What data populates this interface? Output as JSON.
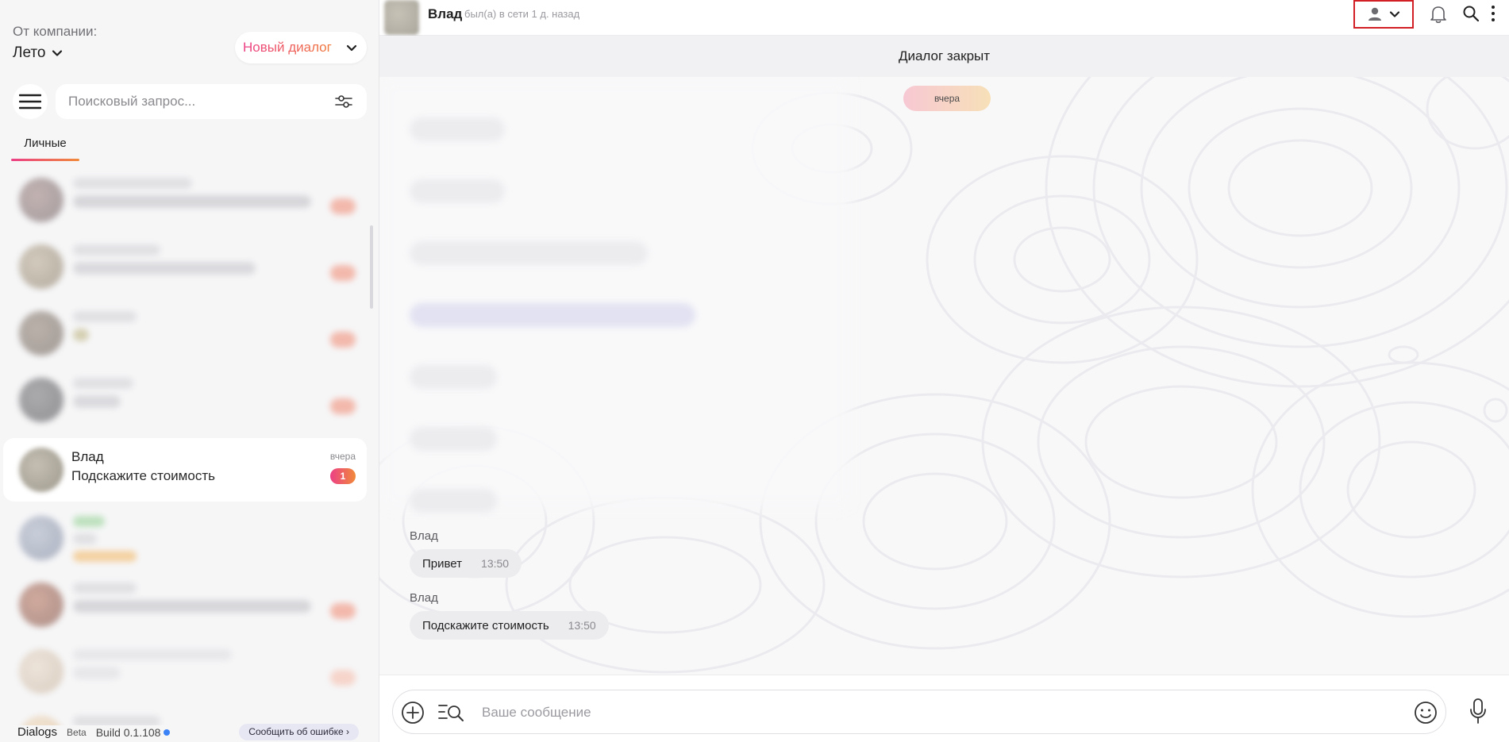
{
  "sidebar": {
    "company_label": "От компании:",
    "company_value": "Лето",
    "new_dialog_label": "Новый диалог",
    "search_placeholder": "Поисковый запрос...",
    "tabs": [
      {
        "label": "Личные"
      }
    ],
    "active_chat": {
      "name": "Влад",
      "preview": "Подскажите стоимость",
      "time": "вчера",
      "unread": "1"
    },
    "footer": {
      "app_name": "Dialogs",
      "beta": "Beta",
      "build": "Build 0.1.108",
      "report_label": "Сообщить об ошибке ›"
    }
  },
  "header": {
    "contact_name": "Влад",
    "contact_status": "был(а) в сети 1 д. назад"
  },
  "chat": {
    "closed_banner": "Диалог закрыт",
    "date_chip": "вчера",
    "messages": [
      {
        "sender": "Влад",
        "text": "Привет",
        "time": "13:50"
      },
      {
        "sender": "Влад",
        "text": "Подскажите стоимость",
        "time": "13:50"
      }
    ]
  },
  "composer": {
    "placeholder": "Ваше сообщение"
  },
  "colors": {
    "accent_start": "#ec3f86",
    "accent_end": "#f08a3a",
    "highlight_border": "#d21f26"
  },
  "icons": [
    "chevron-down-icon",
    "menu-icon",
    "filter-icon",
    "user-icon",
    "bell-icon",
    "search-icon",
    "more-vertical-icon",
    "plus-circle-icon",
    "template-search-icon",
    "emoji-icon",
    "microphone-icon"
  ]
}
